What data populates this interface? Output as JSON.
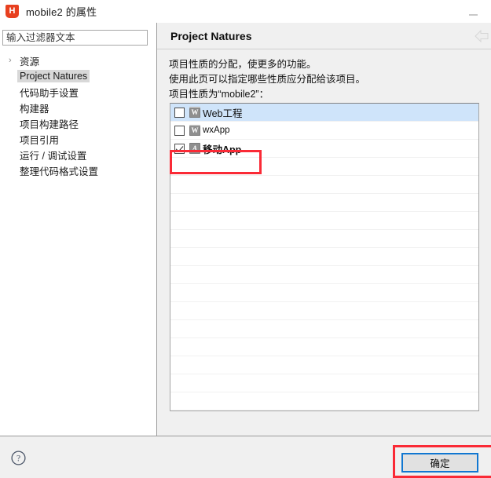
{
  "window": {
    "title": "mobile2 的属性",
    "app_icon": "hbuilder-shield-icon",
    "minimize_label": "minimize-icon"
  },
  "sidebar": {
    "filter": {
      "placeholder": "输入过滤器文本",
      "value": ""
    },
    "items": [
      {
        "label": "资源",
        "expandable": true,
        "chevron": "›",
        "selected": false
      },
      {
        "label": "Project Natures",
        "expandable": false,
        "chevron": "",
        "selected": true
      },
      {
        "label": "代码助手设置",
        "expandable": false,
        "chevron": "",
        "selected": false
      },
      {
        "label": "构建器",
        "expandable": false,
        "chevron": "",
        "selected": false
      },
      {
        "label": "项目构建路径",
        "expandable": false,
        "chevron": "",
        "selected": false
      },
      {
        "label": "项目引用",
        "expandable": false,
        "chevron": "",
        "selected": false
      },
      {
        "label": "运行 / 调试设置",
        "expandable": false,
        "chevron": "",
        "selected": false
      },
      {
        "label": "整理代码格式设置",
        "expandable": false,
        "chevron": "",
        "selected": false
      }
    ]
  },
  "main": {
    "page_title": "Project Natures",
    "back_icon": "back-arrow-icon",
    "description_lines": [
      "项目性质的分配，使更多的功能。",
      "使用此页可以指定哪些性质应分配给该项目。",
      "项目性质为“mobile2”："
    ],
    "natures": [
      {
        "label": "Web工程",
        "checked": false,
        "icon": "W",
        "icon_type": "web",
        "selected": true,
        "bold": false
      },
      {
        "label": "wxApp",
        "checked": false,
        "icon": "W",
        "icon_type": "web",
        "selected": false,
        "bold": false
      },
      {
        "label": "移动App",
        "checked": true,
        "icon": "A",
        "icon_type": "app",
        "selected": false,
        "bold": true
      }
    ],
    "empty_row_count": 14
  },
  "footer": {
    "help_icon": "help-circle-icon",
    "ok_label": "确定"
  },
  "annotations": {
    "highlight_color": "#fa2a36",
    "focus_color": "#1177d1",
    "selection_color": "#cfe4fa"
  }
}
